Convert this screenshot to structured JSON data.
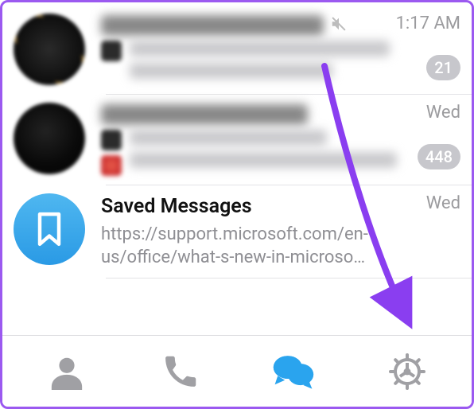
{
  "chats": [
    {
      "title": "Chat title redacted",
      "time": "1:17 AM",
      "muted": true,
      "unread": "21",
      "preview": "Message preview redacted"
    },
    {
      "title": "Chat title redacted",
      "time": "Wed",
      "muted": false,
      "unread": "448",
      "preview": "Message preview redacted"
    },
    {
      "title": "Saved Messages",
      "time": "Wed",
      "muted": false,
      "unread": null,
      "preview": "https://support.microsoft.com/en-us/office/what-s-new-in-microso…"
    }
  ],
  "tabs": {
    "contacts": "Contacts",
    "calls": "Calls",
    "chats": "Chats",
    "settings": "Settings"
  },
  "annotation": {
    "target": "settings-tab"
  }
}
